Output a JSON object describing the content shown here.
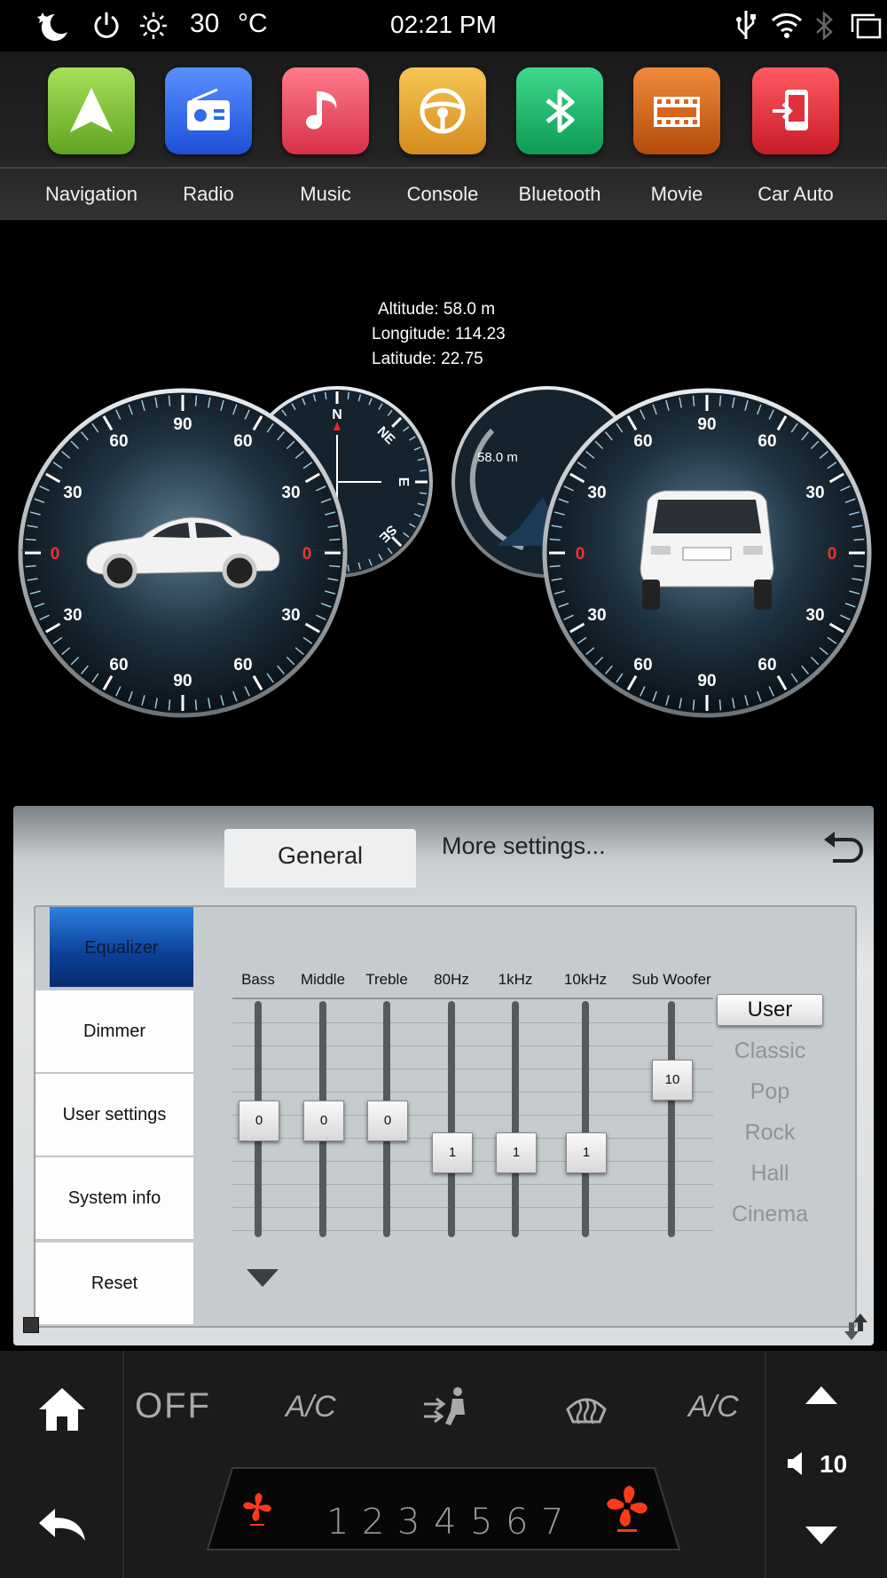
{
  "status_bar": {
    "temperature": "30",
    "unit": "°C",
    "time": "02:21 PM"
  },
  "apps": [
    {
      "label": "Navigation",
      "color": "#7cc23a"
    },
    {
      "label": "Radio",
      "color": "#2f6be6"
    },
    {
      "label": "Music",
      "color": "#e0475e"
    },
    {
      "label": "Console",
      "color": "#e0a12c"
    },
    {
      "label": "Bluetooth",
      "color": "#20b86a"
    },
    {
      "label": "Movie",
      "color": "#d9651a"
    },
    {
      "label": "Car Auto",
      "color": "#e0303b"
    }
  ],
  "gps": {
    "altitude": "Altitude:  58.0 m",
    "longitude": "Longitude: 114.23",
    "latitude": "Latitude: 22.75"
  },
  "gauges": {
    "left_ticks": [
      "90",
      "60",
      "60",
      "30",
      "30",
      "0",
      "0",
      "30",
      "30",
      "60",
      "60",
      "90"
    ],
    "right_ticks": [
      "90",
      "60",
      "60",
      "30",
      "30",
      "0",
      "0",
      "30",
      "30",
      "60",
      "60",
      "90"
    ],
    "compass": [
      "N",
      "NE",
      "E",
      "SE"
    ],
    "altimeter": "58.0 m"
  },
  "settings": {
    "tabs": {
      "general": "General",
      "more": "More settings..."
    },
    "sidebar": [
      "Equalizer",
      "Dimmer",
      "User settings",
      "System info",
      "Reset"
    ],
    "channels": [
      {
        "label": "Bass",
        "value": "0"
      },
      {
        "label": "Middle",
        "value": "0"
      },
      {
        "label": "Treble",
        "value": "0"
      },
      {
        "label": "80Hz",
        "value": "1"
      },
      {
        "label": "1kHz",
        "value": "1"
      },
      {
        "label": "10kHz",
        "value": "1"
      },
      {
        "label": "Sub Woofer",
        "value": "10"
      }
    ],
    "presets": {
      "selected": "User",
      "others": [
        "Classic",
        "Pop",
        "Rock",
        "Hall",
        "Cinema"
      ]
    }
  },
  "climate": {
    "off": "OFF",
    "ac1": "A/C",
    "ac2": "A/C",
    "volume": "10",
    "fan_steps": [
      "1",
      "2",
      "3",
      "4",
      "5",
      "6",
      "7"
    ]
  }
}
